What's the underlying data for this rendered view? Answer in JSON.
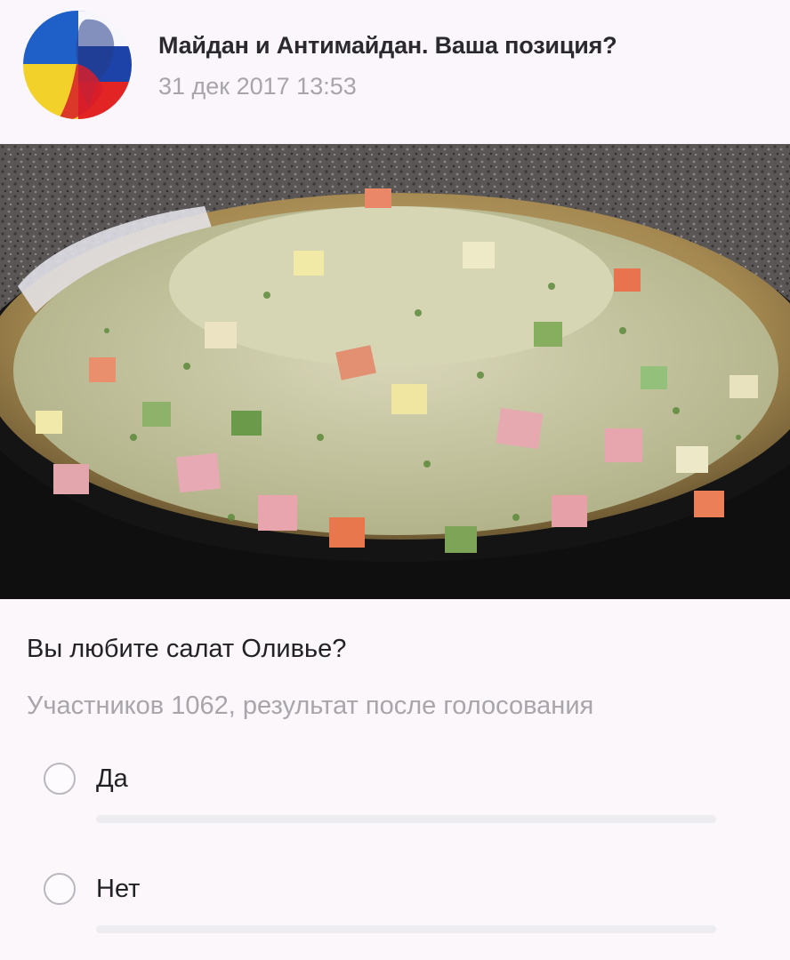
{
  "post": {
    "group_title": "Майдан и Антимайдан. Ваша позиция?",
    "date": "31 дек 2017 13:53",
    "avatar_icon": "group-avatar-flags",
    "image_subject": "olivier-salad"
  },
  "poll": {
    "question": "Вы любите салат Оливье?",
    "meta": "Участников 1062, результат после голосования",
    "options": [
      {
        "label": "Да"
      },
      {
        "label": "Нет"
      }
    ]
  },
  "colors": {
    "background": "#fbf7fb",
    "title_text": "#2a2a2e",
    "secondary_text": "#a8a5ab",
    "radio_border": "#b9b6bd",
    "bar_track": "#ececf1"
  }
}
